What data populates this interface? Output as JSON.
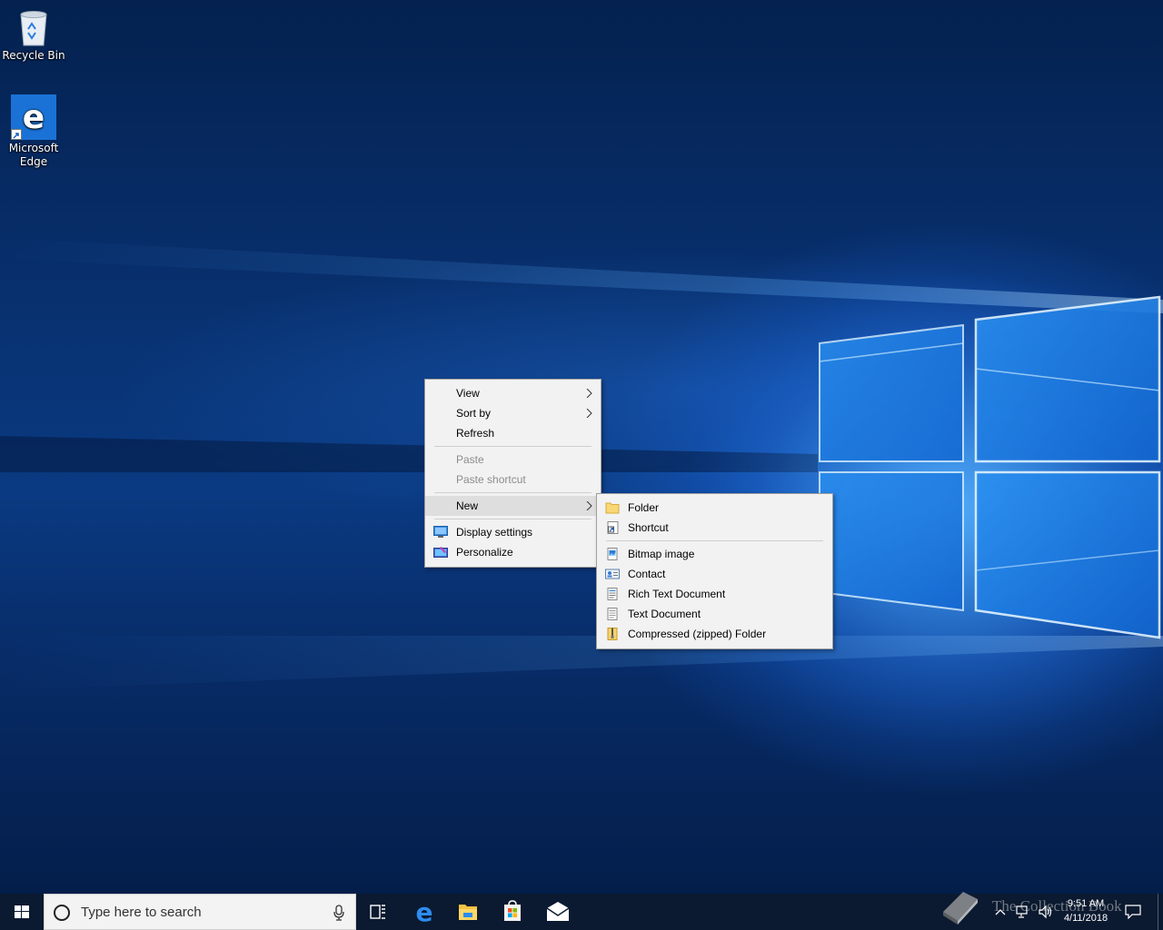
{
  "desktop": {
    "icons": [
      {
        "label": "Recycle Bin",
        "icon": "recycle-bin-icon"
      },
      {
        "label": "Microsoft\nEdge",
        "label_line1": "Microsoft",
        "label_line2": "Edge",
        "icon": "edge-icon"
      }
    ]
  },
  "context_menu": {
    "items": [
      {
        "label": "View",
        "submenu": true,
        "enabled": true
      },
      {
        "label": "Sort by",
        "submenu": true,
        "enabled": true
      },
      {
        "label": "Refresh",
        "enabled": true
      },
      {
        "label": "Paste",
        "enabled": false
      },
      {
        "label": "Paste shortcut",
        "enabled": false
      },
      {
        "label": "New",
        "submenu": true,
        "enabled": true,
        "highlighted": true
      },
      {
        "label": "Display settings",
        "icon": "display-settings-icon",
        "enabled": true
      },
      {
        "label": "Personalize",
        "icon": "personalize-icon",
        "enabled": true
      }
    ]
  },
  "new_submenu": {
    "items": [
      {
        "label": "Folder",
        "icon": "folder-icon"
      },
      {
        "label": "Shortcut",
        "icon": "shortcut-icon"
      },
      {
        "label": "Bitmap image",
        "icon": "bitmap-image-icon"
      },
      {
        "label": "Contact",
        "icon": "contact-icon"
      },
      {
        "label": "Rich Text Document",
        "icon": "rich-text-document-icon"
      },
      {
        "label": "Text Document",
        "icon": "text-document-icon"
      },
      {
        "label": "Compressed (zipped) Folder",
        "icon": "zipped-folder-icon"
      }
    ]
  },
  "taskbar": {
    "search_placeholder": "Type here to search",
    "pinned": [
      "task-view-icon",
      "edge-icon",
      "file-explorer-icon",
      "store-icon",
      "mail-icon"
    ],
    "clock": {
      "time": "9:51 AM",
      "date": "4/11/2018"
    },
    "watermark": "The Collection Book"
  },
  "colors": {
    "wallpaper_dark": "#04214f",
    "wallpaper_light": "#369eff",
    "menu_bg": "#f2f2f2",
    "menu_highlight": "#dedede",
    "taskbar_bg": "#0b1a30",
    "disabled_text": "#8d8d8d"
  }
}
